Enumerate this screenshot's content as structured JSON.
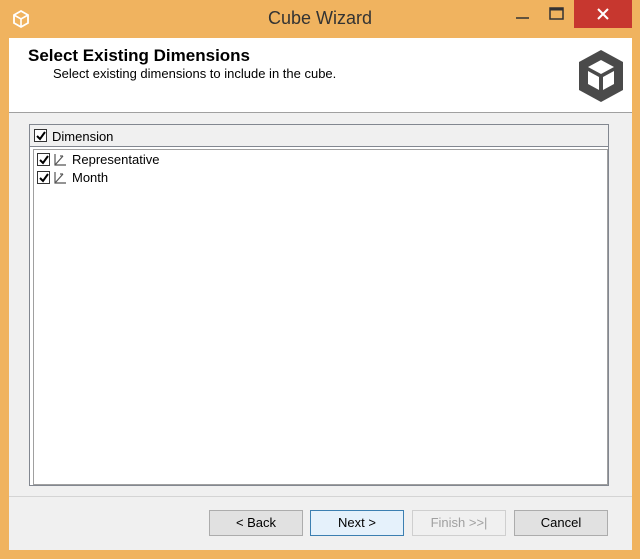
{
  "window": {
    "title": "Cube Wizard",
    "accent": "#f0b35f",
    "close_color": "#c7372f"
  },
  "header": {
    "title": "Select Existing Dimensions",
    "subtitle": "Select existing dimensions to include in the cube."
  },
  "list": {
    "column_header": "Dimension",
    "header_checked": true,
    "items": [
      {
        "label": "Representative",
        "checked": true,
        "icon": "dimension-icon"
      },
      {
        "label": "Month",
        "checked": true,
        "icon": "dimension-icon"
      }
    ]
  },
  "buttons": {
    "back": "< Back",
    "next": "Next >",
    "finish": "Finish >>|",
    "cancel": "Cancel"
  }
}
